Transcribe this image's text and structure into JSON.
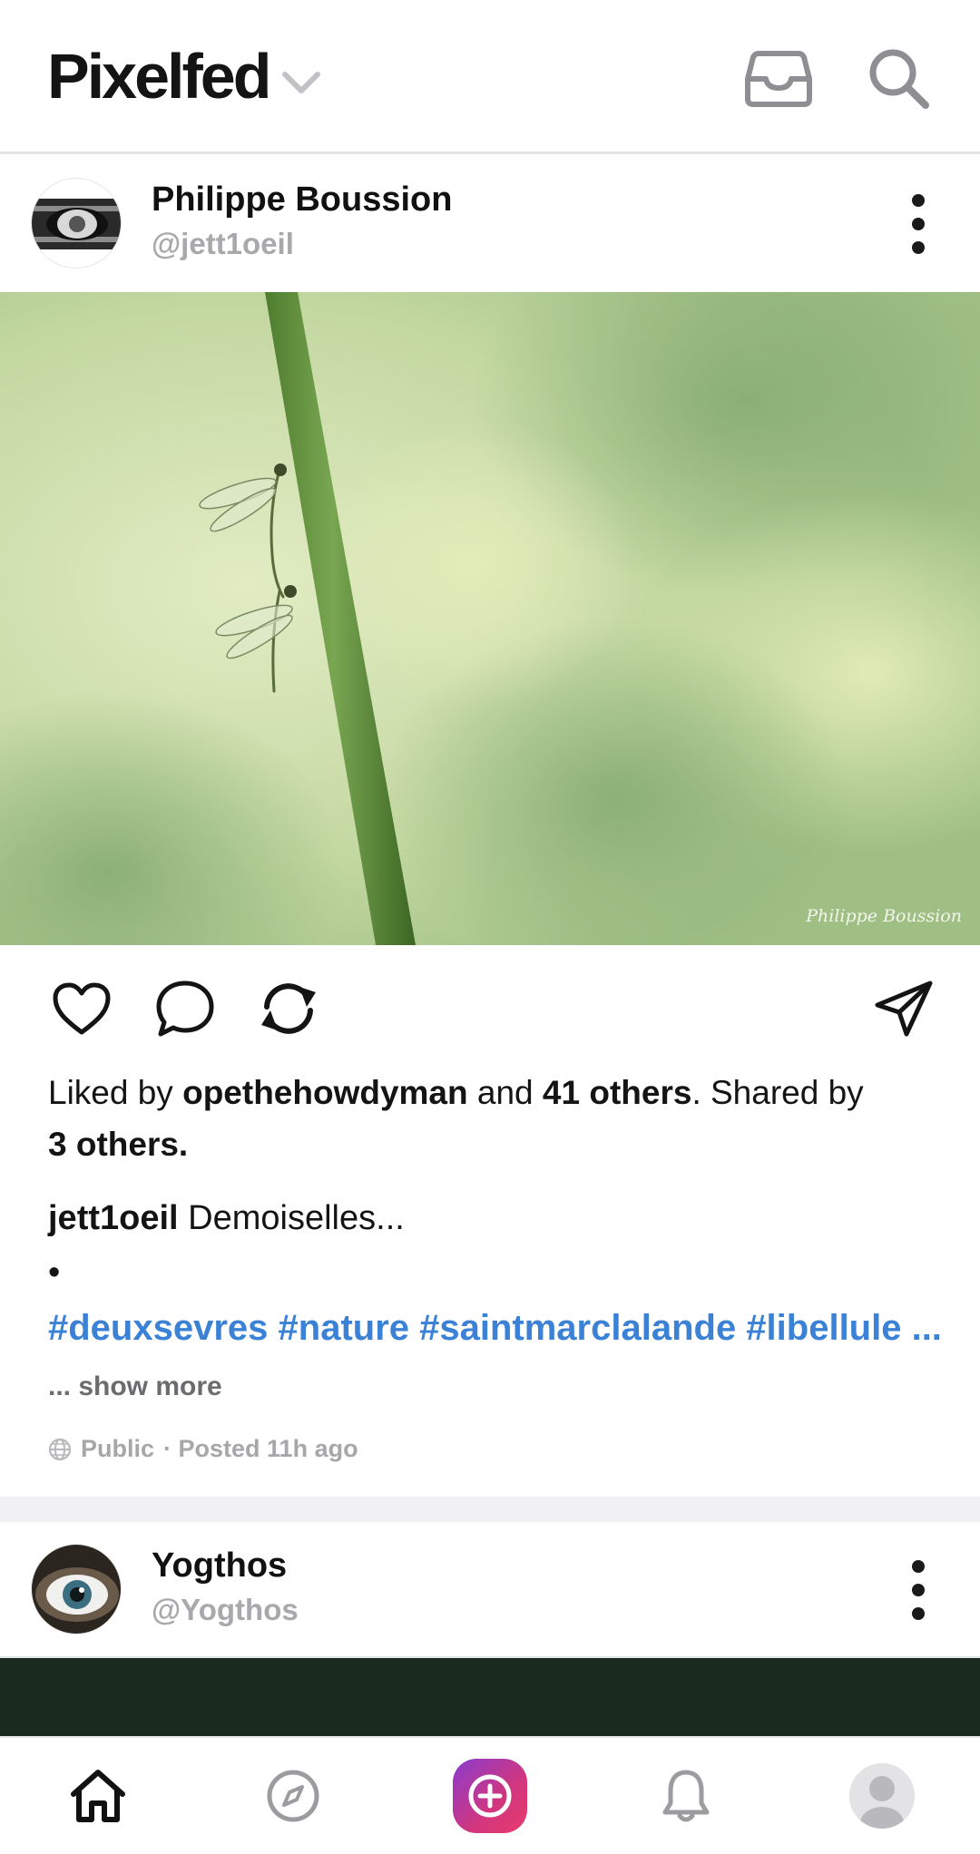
{
  "header": {
    "title": "Pixelfed",
    "icons": {
      "menu": "chevron-down-icon",
      "inbox": "inbox-icon",
      "search": "search-icon"
    }
  },
  "post1": {
    "display_name": "Philippe Boussion",
    "username": "@jett1oeil",
    "image_watermark": "Philippe Boussion",
    "likes": {
      "prefix": "Liked by",
      "user": "opethehowdyman",
      "and": "and",
      "others_count": "41 others",
      "shared_text": ". Shared by",
      "shared_count": "3 others."
    },
    "caption": {
      "user": "jett1oeil",
      "text": "Demoiselles...",
      "bullet": "•"
    },
    "hashtags": "#deuxsevres #nature #saintmarclalande #libellule ...",
    "show_more": "... show more",
    "visibility": "Public",
    "posted": "· Posted 11h ago"
  },
  "post2": {
    "display_name": "Yogthos",
    "username": "@Yogthos"
  },
  "colors": {
    "hashtag": "#3b82d6",
    "muted": "#a6a6ab",
    "add_gradient_start": "#8a3ccf",
    "add_gradient_end": "#ea3b6c"
  },
  "nav": {
    "items": [
      "home-icon",
      "compass-icon",
      "add-post-icon",
      "bell-icon",
      "profile-avatar"
    ]
  }
}
